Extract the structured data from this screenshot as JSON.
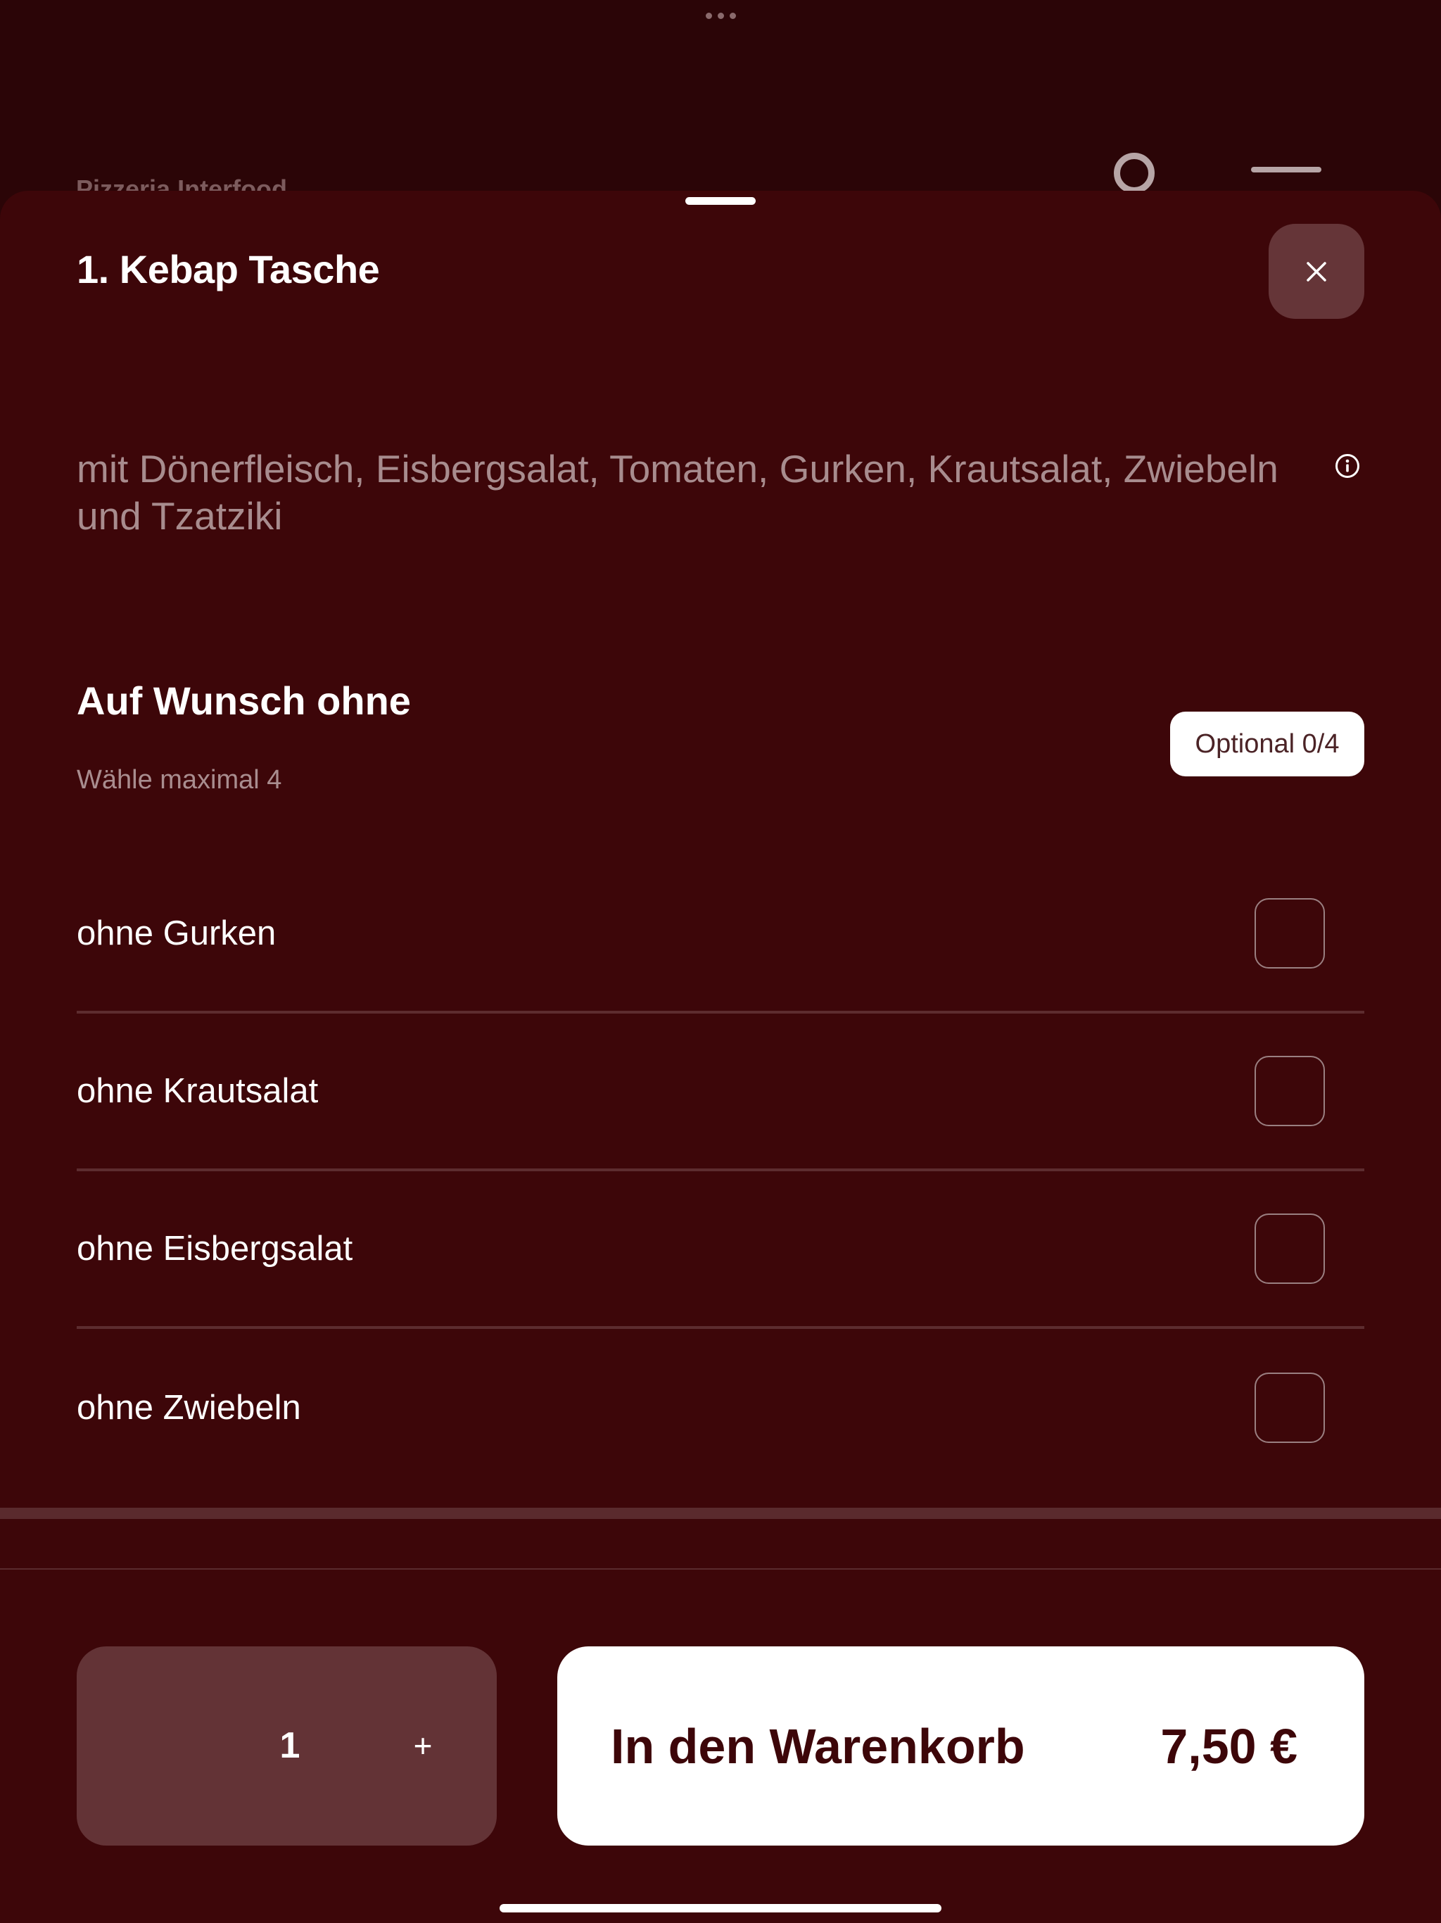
{
  "background": {
    "restaurant_name": "Pizzeria Interfood",
    "icons": [
      "search-icon",
      "menu-icon"
    ]
  },
  "sheet": {
    "title": "1. Kebap Tasche",
    "description": "mit Dönerfleisch, Eisbergsalat, Tomaten, Gurken, Krautsalat, Zwiebeln und Tzatziki",
    "close_icon": "close-icon",
    "info_icon": "info-icon"
  },
  "option_group": {
    "title": "Auf Wunsch ohne",
    "subtitle": "Wähle maximal 4",
    "badge": "Optional 0/4",
    "items": [
      {
        "label": "ohne Gurken",
        "checked": false
      },
      {
        "label": "ohne Krautsalat",
        "checked": false
      },
      {
        "label": "ohne Eisbergsalat",
        "checked": false
      },
      {
        "label": "ohne Zwiebeln",
        "checked": false
      }
    ]
  },
  "footer": {
    "quantity": "1",
    "plus_label": "+",
    "add_to_cart_label": "In den Warenkorb",
    "price": "7,50 €"
  },
  "colors": {
    "background": "#2b0507",
    "sheet": "#3d0609",
    "accent_button": "#ffffff",
    "secondary_button": "#633336"
  }
}
